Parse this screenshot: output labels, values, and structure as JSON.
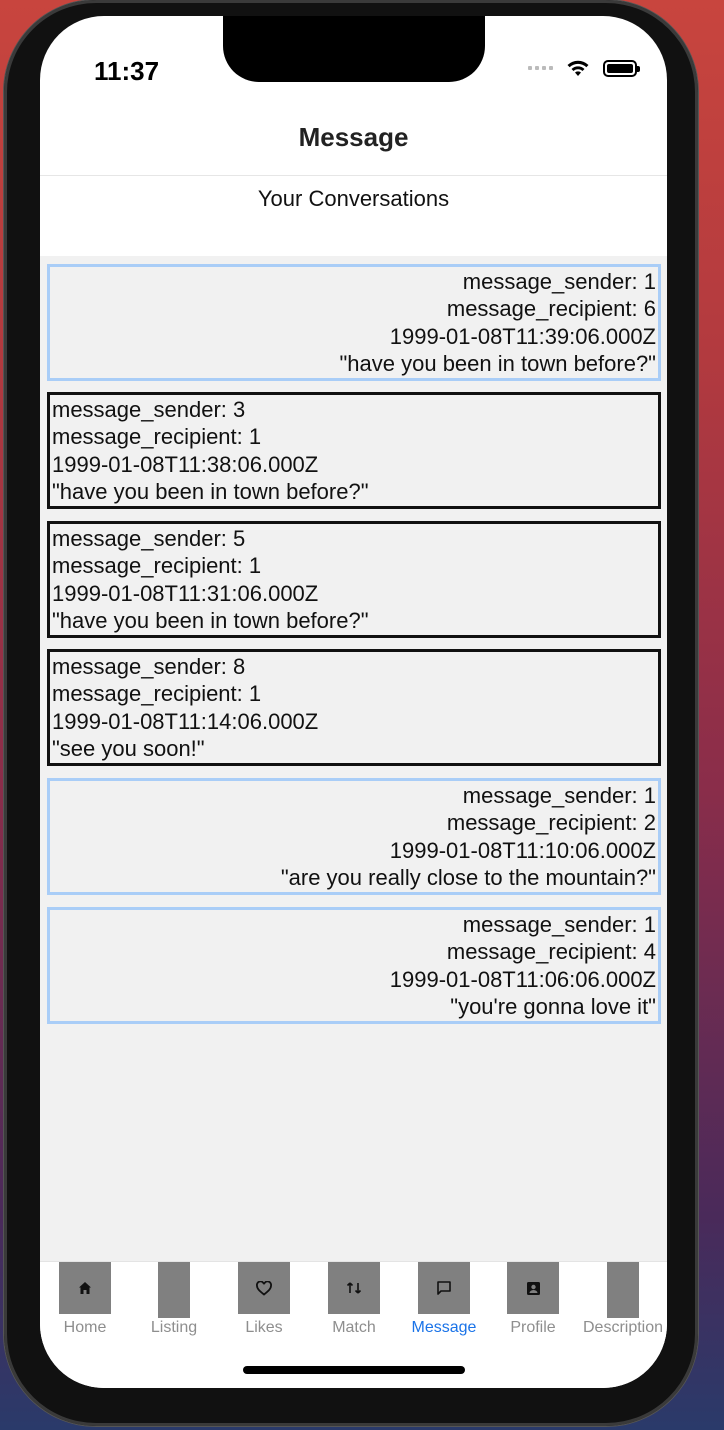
{
  "status": {
    "time": "11:37"
  },
  "header": {
    "title": "Message",
    "subtitle": "Your Conversations"
  },
  "messages": [
    {
      "kind": "sent",
      "sender": "message_sender: 1",
      "recipient": "message_recipient: 6",
      "timestamp": "1999-01-08T11:39:06.000Z",
      "text": "\"have you been in town before?\""
    },
    {
      "kind": "recv",
      "sender": "message_sender: 3",
      "recipient": "message_recipient: 1",
      "timestamp": "1999-01-08T11:38:06.000Z",
      "text": "\"have you been in town before?\""
    },
    {
      "kind": "recv",
      "sender": "message_sender: 5",
      "recipient": "message_recipient: 1",
      "timestamp": "1999-01-08T11:31:06.000Z",
      "text": "\"have you been in town before?\""
    },
    {
      "kind": "recv",
      "sender": "message_sender: 8",
      "recipient": "message_recipient: 1",
      "timestamp": "1999-01-08T11:14:06.000Z",
      "text": "\"see you soon!\""
    },
    {
      "kind": "sent",
      "sender": "message_sender: 1",
      "recipient": "message_recipient: 2",
      "timestamp": "1999-01-08T11:10:06.000Z",
      "text": "\"are you really close to the mountain?\""
    },
    {
      "kind": "sent",
      "sender": "message_sender: 1",
      "recipient": "message_recipient: 4",
      "timestamp": "1999-01-08T11:06:06.000Z",
      "text": "\"you're gonna love it\""
    }
  ],
  "tabs": [
    {
      "label": "Home",
      "icon": "home-icon"
    },
    {
      "label": "Listing",
      "icon": "listing-icon"
    },
    {
      "label": "Likes",
      "icon": "heart-icon"
    },
    {
      "label": "Match",
      "icon": "match-icon"
    },
    {
      "label": "Message",
      "icon": "chat-icon",
      "active": true
    },
    {
      "label": "Profile",
      "icon": "profile-icon"
    },
    {
      "label": "Description",
      "icon": "description-icon"
    }
  ],
  "colors": {
    "active_tab": "#1a73e8",
    "sent_border": "#a9cdf7",
    "recv_border": "#111111"
  }
}
